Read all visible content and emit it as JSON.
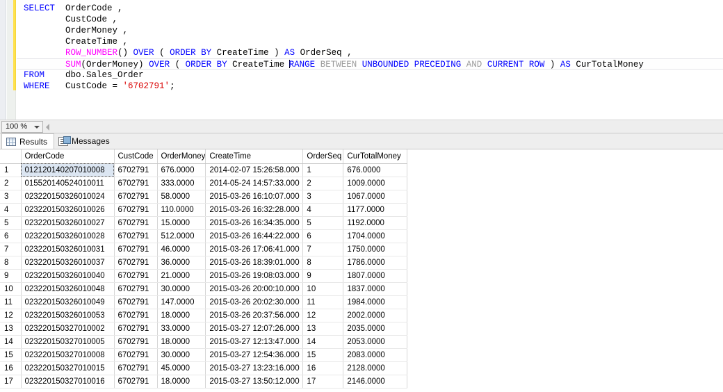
{
  "editor": {
    "zoom_level": "100 %",
    "lines": [
      [
        {
          "t": "SELECT",
          "c": "kw"
        },
        {
          "t": "  OrderCode ,",
          "c": "id"
        }
      ],
      [
        {
          "t": "        CustCode ,",
          "c": "id"
        }
      ],
      [
        {
          "t": "        OrderMoney ,",
          "c": "id"
        }
      ],
      [
        {
          "t": "        CreateTime ,",
          "c": "id"
        }
      ],
      [
        {
          "t": "        ",
          "c": "id"
        },
        {
          "t": "ROW_NUMBER",
          "c": "fn"
        },
        {
          "t": "() ",
          "c": "id"
        },
        {
          "t": "OVER",
          "c": "kw"
        },
        {
          "t": " ( ",
          "c": "id"
        },
        {
          "t": "ORDER",
          "c": "kw"
        },
        {
          "t": " ",
          "c": "id"
        },
        {
          "t": "BY",
          "c": "kw"
        },
        {
          "t": " CreateTime ) ",
          "c": "id"
        },
        {
          "t": "AS",
          "c": "kw"
        },
        {
          "t": " OrderSeq ,",
          "c": "id"
        }
      ],
      [
        {
          "t": "        ",
          "c": "id"
        },
        {
          "t": "SUM",
          "c": "fn"
        },
        {
          "t": "(OrderMoney) ",
          "c": "id"
        },
        {
          "t": "OVER",
          "c": "kw"
        },
        {
          "t": " ( ",
          "c": "id"
        },
        {
          "t": "ORDER",
          "c": "kw"
        },
        {
          "t": " ",
          "c": "id"
        },
        {
          "t": "BY",
          "c": "kw"
        },
        {
          "t": " CreateTime ",
          "c": "id"
        },
        {
          "t": "RANGE",
          "c": "kw"
        },
        {
          "t": " ",
          "c": "id"
        },
        {
          "t": "BETWEEN",
          "c": "gray"
        },
        {
          "t": " ",
          "c": "id"
        },
        {
          "t": "UNBOUNDED",
          "c": "kw"
        },
        {
          "t": " ",
          "c": "id"
        },
        {
          "t": "PRECEDING",
          "c": "kw"
        },
        {
          "t": " ",
          "c": "id"
        },
        {
          "t": "AND",
          "c": "gray"
        },
        {
          "t": " ",
          "c": "id"
        },
        {
          "t": "CURRENT",
          "c": "kw"
        },
        {
          "t": " ",
          "c": "id"
        },
        {
          "t": "ROW",
          "c": "kw"
        },
        {
          "t": " ) ",
          "c": "id"
        },
        {
          "t": "AS",
          "c": "kw"
        },
        {
          "t": " CurTotalMoney",
          "c": "id"
        }
      ],
      [
        {
          "t": "FROM",
          "c": "kw"
        },
        {
          "t": "    dbo.Sales_Order",
          "c": "id"
        }
      ],
      [
        {
          "t": "WHERE",
          "c": "kw"
        },
        {
          "t": "   CustCode = ",
          "c": "id"
        },
        {
          "t": "'6702791'",
          "c": "str"
        },
        {
          "t": ";",
          "c": "id"
        }
      ]
    ],
    "current_line_index": 5
  },
  "tabs": [
    {
      "id": "results",
      "label": "Results",
      "icon": "grid-icon",
      "active": true
    },
    {
      "id": "messages",
      "label": "Messages",
      "icon": "messages-icon",
      "active": false
    }
  ],
  "grid": {
    "columns": [
      "OrderCode",
      "CustCode",
      "OrderMoney",
      "CreateTime",
      "OrderSeq",
      "CurTotalMoney"
    ],
    "rows": [
      {
        "n": "1",
        "cells": [
          "012120140207010008",
          "6702791",
          "676.0000",
          "2014-02-07 15:26:58.000",
          "1",
          "676.0000"
        ]
      },
      {
        "n": "2",
        "cells": [
          "015520140524010011",
          "6702791",
          "333.0000",
          "2014-05-24 14:57:33.000",
          "2",
          "1009.0000"
        ]
      },
      {
        "n": "3",
        "cells": [
          "023220150326010024",
          "6702791",
          "58.0000",
          "2015-03-26 16:10:07.000",
          "3",
          "1067.0000"
        ]
      },
      {
        "n": "4",
        "cells": [
          "023220150326010026",
          "6702791",
          "110.0000",
          "2015-03-26 16:32:28.000",
          "4",
          "1177.0000"
        ]
      },
      {
        "n": "5",
        "cells": [
          "023220150326010027",
          "6702791",
          "15.0000",
          "2015-03-26 16:34:35.000",
          "5",
          "1192.0000"
        ]
      },
      {
        "n": "6",
        "cells": [
          "023220150326010028",
          "6702791",
          "512.0000",
          "2015-03-26 16:44:22.000",
          "6",
          "1704.0000"
        ]
      },
      {
        "n": "7",
        "cells": [
          "023220150326010031",
          "6702791",
          "46.0000",
          "2015-03-26 17:06:41.000",
          "7",
          "1750.0000"
        ]
      },
      {
        "n": "8",
        "cells": [
          "023220150326010037",
          "6702791",
          "36.0000",
          "2015-03-26 18:39:01.000",
          "8",
          "1786.0000"
        ]
      },
      {
        "n": "9",
        "cells": [
          "023220150326010040",
          "6702791",
          "21.0000",
          "2015-03-26 19:08:03.000",
          "9",
          "1807.0000"
        ]
      },
      {
        "n": "10",
        "cells": [
          "023220150326010048",
          "6702791",
          "30.0000",
          "2015-03-26 20:00:10.000",
          "10",
          "1837.0000"
        ]
      },
      {
        "n": "11",
        "cells": [
          "023220150326010049",
          "6702791",
          "147.0000",
          "2015-03-26 20:02:30.000",
          "11",
          "1984.0000"
        ]
      },
      {
        "n": "12",
        "cells": [
          "023220150326010053",
          "6702791",
          "18.0000",
          "2015-03-26 20:37:56.000",
          "12",
          "2002.0000"
        ]
      },
      {
        "n": "13",
        "cells": [
          "023220150327010002",
          "6702791",
          "33.0000",
          "2015-03-27 12:07:26.000",
          "13",
          "2035.0000"
        ]
      },
      {
        "n": "14",
        "cells": [
          "023220150327010005",
          "6702791",
          "18.0000",
          "2015-03-27 12:13:47.000",
          "14",
          "2053.0000"
        ]
      },
      {
        "n": "15",
        "cells": [
          "023220150327010008",
          "6702791",
          "30.0000",
          "2015-03-27 12:54:36.000",
          "15",
          "2083.0000"
        ]
      },
      {
        "n": "16",
        "cells": [
          "023220150327010015",
          "6702791",
          "45.0000",
          "2015-03-27 13:23:16.000",
          "16",
          "2128.0000"
        ]
      },
      {
        "n": "17",
        "cells": [
          "023220150327010016",
          "6702791",
          "18.0000",
          "2015-03-27 13:50:12.000",
          "17",
          "2146.0000"
        ]
      }
    ],
    "selected_cell": {
      "row": 0,
      "col": 0
    }
  },
  "colors": {
    "keyword": "#0000ff",
    "function": "#ff00ff",
    "string": "#d90000",
    "noise_keyword": "#9b9b9b",
    "change_bar": "#ffe14d",
    "selection": "#dce6f2"
  }
}
